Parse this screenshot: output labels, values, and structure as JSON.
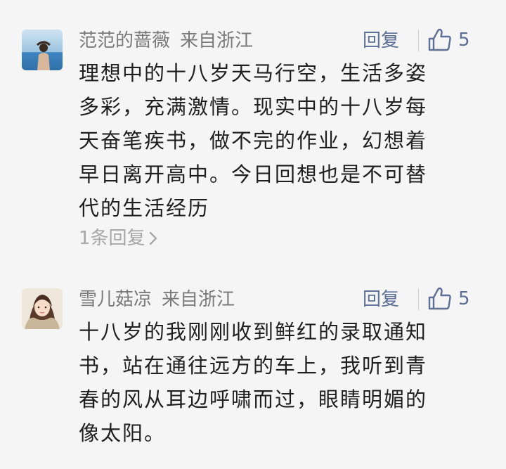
{
  "comments": [
    {
      "user": "范范的蔷薇",
      "location": "来自浙江",
      "reply_label": "回复",
      "likes": "5",
      "lines": [
        "理想中的十八岁天马行空，生活多姿",
        "多彩，充满激情。现实中的十八岁每",
        "天奋笔疾书，做不完的作业，幻想着",
        "早日离开高中。今日回想也是不可替",
        "代的生活经历"
      ],
      "replies_label": "1条回复"
    },
    {
      "user": "雪儿菇凉",
      "location": "来自浙江",
      "reply_label": "回复",
      "likes": "5",
      "lines": [
        "十八岁的我刚刚收到鲜红的录取通知",
        "书，站在通往远方的车上，我听到青",
        "春的风从耳边呼啸而过，眼睛明媚的",
        "像太阳。"
      ]
    }
  ],
  "icons": {
    "like": "thumbs-up-icon",
    "chevron": "chevron-right-icon"
  },
  "colors": {
    "link": "#5d6f94",
    "name": "#7a7a7a",
    "muted": "#a7a7a7",
    "background": "#f5f5f5"
  }
}
